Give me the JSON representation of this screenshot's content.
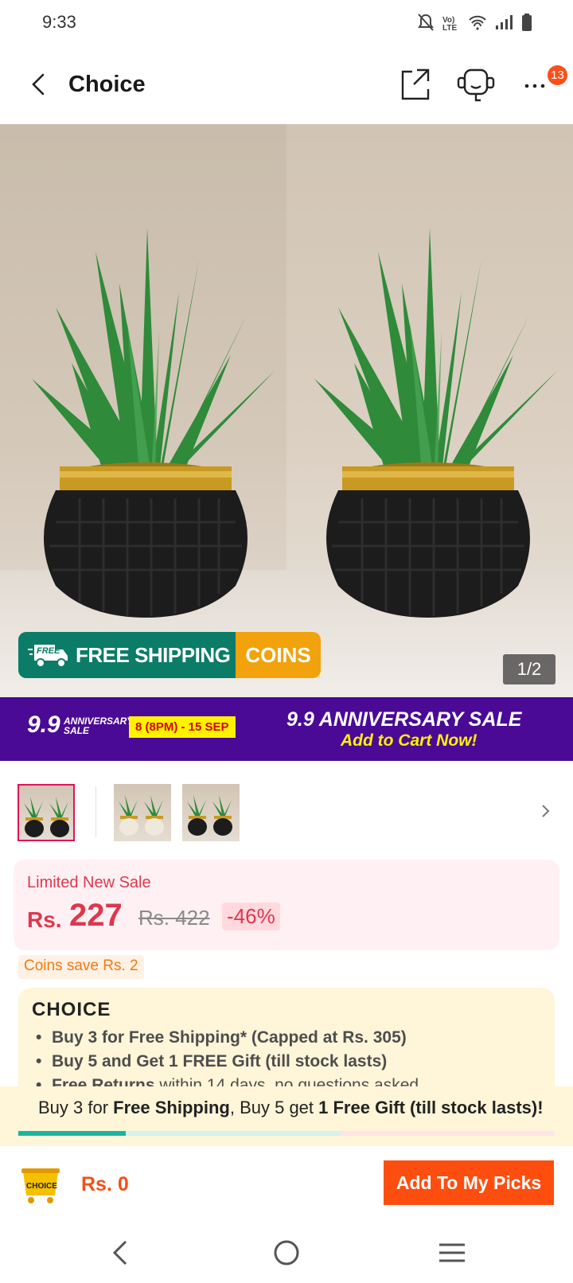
{
  "status_bar": {
    "time": "9:33",
    "icons": [
      "mute-icon",
      "volte-icon",
      "wifi-icon",
      "signal-icon",
      "battery-icon"
    ],
    "volte_label": "Vo) LTE"
  },
  "header": {
    "title": "Choice",
    "notification_count": "13"
  },
  "hero": {
    "shipping_label": "FREE SHIPPING",
    "free_tag": "FREE",
    "coins_label": "COINS",
    "page_indicator": "1/2"
  },
  "sale_banner": {
    "logo_number": "9.9",
    "logo_text": "ANNIVERSARY SALE",
    "dates": "8 (8PM) - 15 SEP",
    "title": "9.9 ANNIVERSARY SALE",
    "cta": "Add to Cart Now!"
  },
  "price": {
    "label": "Limited New Sale",
    "currency": "Rs.",
    "current": "227",
    "original": "Rs. 422",
    "discount": "-46%"
  },
  "coins_tag": "Coins save Rs. 2",
  "choice": {
    "logo": "CHOICE",
    "benefits": [
      {
        "text": "Buy 3 for  Free Shipping* (Capped at Rs. 305)",
        "muted": ""
      },
      {
        "text": "Buy 5 and Get 1 FREE Gift (till stock lasts)",
        "muted": ""
      },
      {
        "text": "Free Returns",
        "muted": " within 14 days, no questions asked"
      }
    ]
  },
  "promo": {
    "part1": "Buy 3 for ",
    "bold1": "Free Shipping",
    "part2": ", Buy 5 get ",
    "bold2": "1 Free Gift (till stock lasts)!",
    "progress_fraction": 0.2
  },
  "bottom_bar": {
    "cart_label": "CHOICE",
    "total": "Rs. 0",
    "add_button": "Add To My Picks"
  },
  "colors": {
    "accent": "#fd4e10",
    "price_red": "#e0364d",
    "sale_purple": "#4a0a95",
    "shipping_green": "#0a7c67",
    "coins_orange": "#f2a20c"
  }
}
